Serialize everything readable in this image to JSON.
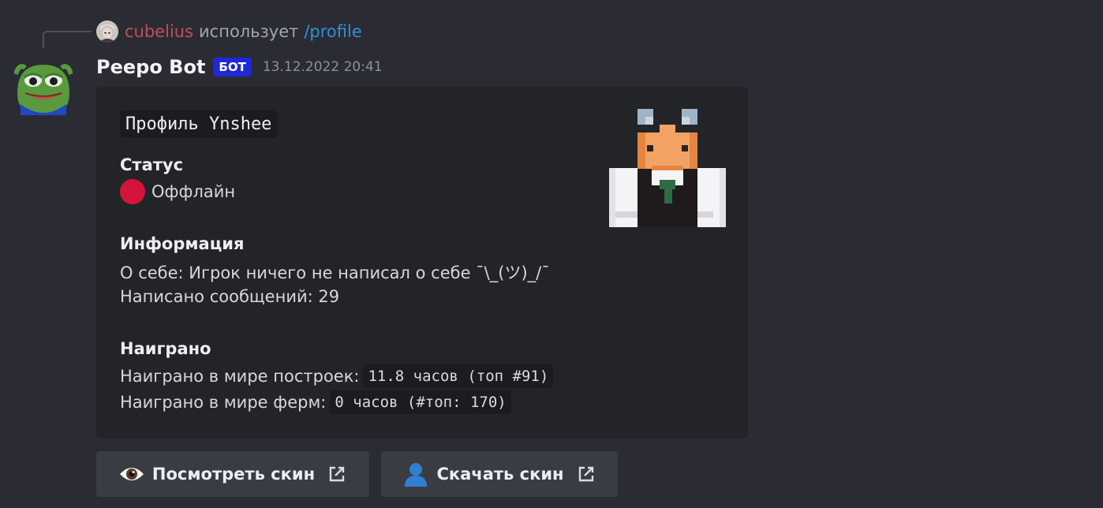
{
  "reply": {
    "username": "cubelius",
    "action_text": "использует",
    "command": "/profile"
  },
  "message": {
    "author": "Peepo Bot",
    "badge": "БОТ",
    "timestamp": "13.12.2022 20:41"
  },
  "embed": {
    "title": "Профиль Ynshee",
    "status": {
      "heading": "Статус",
      "value": "Оффлайн",
      "color": "#d4143b"
    },
    "info": {
      "heading": "Информация",
      "about": "О себе: Игрок ничего не написал о себе ¯\\_(ツ)_/¯",
      "messages": "Написано сообщений: 29"
    },
    "played": {
      "heading": "Наиграно",
      "build_label": "Наиграно в мире построек:",
      "build_value": "11.8 часов (топ #91)",
      "farm_label": "Наиграно в мире ферм:",
      "farm_value": "0 часов (#топ: 170)"
    }
  },
  "buttons": {
    "view_skin": "Посмотреть скин",
    "download_skin": "Скачать скин"
  },
  "icons": {
    "eye": "eye-icon",
    "user": "user-icon",
    "external_link": "external-link-icon"
  },
  "colors": {
    "background": "#2b2c33",
    "embed_background": "#232428",
    "badge": "#1f27d8",
    "button": "#3a3c44"
  }
}
